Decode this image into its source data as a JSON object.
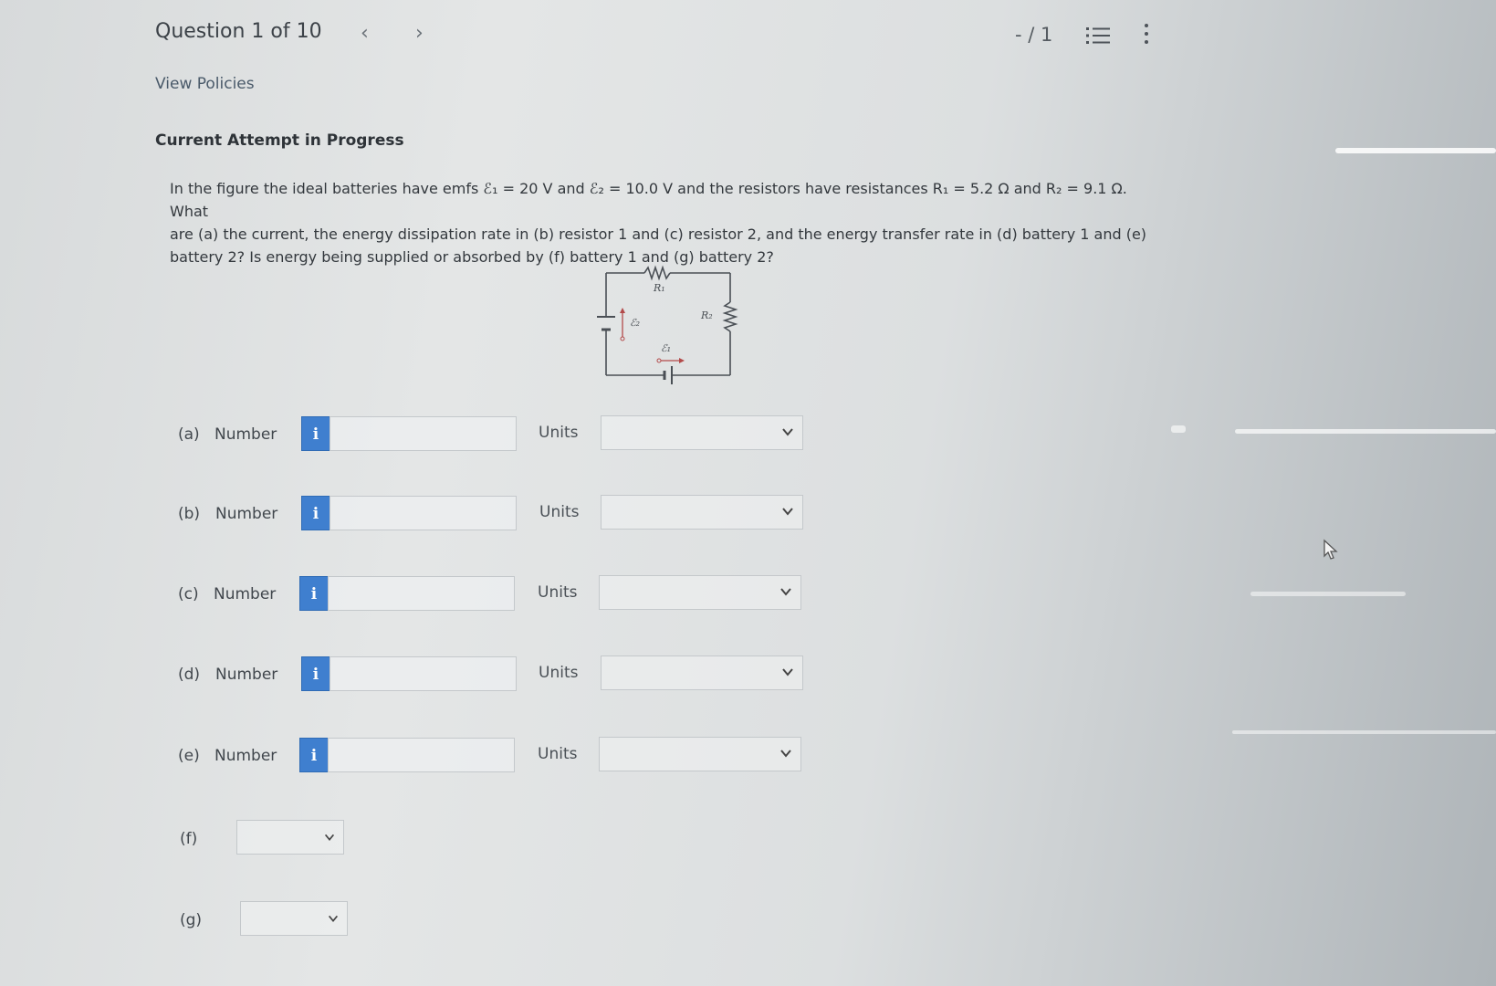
{
  "header": {
    "title": "Question 1 of 10",
    "prev_icon": "chevron-left-icon",
    "next_icon": "chevron-right-icon",
    "score": "- / 1",
    "list_icon": "list-icon",
    "more_icon": "more-vertical-icon"
  },
  "policies_link": "View Policies",
  "status": "Current Attempt in Progress",
  "question": {
    "line1": "In the figure the ideal batteries have emfs ℰ₁ = 20 V and ℰ₂ = 10.0 V and the resistors have resistances R₁ = 5.2 Ω and R₂ = 9.1 Ω. What",
    "line2": "are (a) the current, the energy dissipation rate in (b) resistor 1 and (c) resistor 2, and the energy transfer rate in (d) battery 1 and (e)",
    "line3": "battery 2? Is energy being supplied or absorbed by (f) battery 1 and (g) battery 2?"
  },
  "figure": {
    "r1": "R₁",
    "r2": "R₂",
    "e1": "ℰ₁",
    "e2": "ℰ₂"
  },
  "parts": [
    {
      "label": "(a)",
      "number_label": "Number",
      "info": "i",
      "value": "",
      "units_label": "Units",
      "units_value": ""
    },
    {
      "label": "(b)",
      "number_label": "Number",
      "info": "i",
      "value": "",
      "units_label": "Units",
      "units_value": ""
    },
    {
      "label": "(c)",
      "number_label": "Number",
      "info": "i",
      "value": "",
      "units_label": "Units",
      "units_value": ""
    },
    {
      "label": "(d)",
      "number_label": "Number",
      "info": "i",
      "value": "",
      "units_label": "Units",
      "units_value": ""
    },
    {
      "label": "(e)",
      "number_label": "Number",
      "info": "i",
      "value": "",
      "units_label": "Units",
      "units_value": ""
    }
  ],
  "choice_parts": [
    {
      "label": "(f)",
      "value": ""
    },
    {
      "label": "(g)",
      "value": ""
    }
  ],
  "colors": {
    "info_button": "#3f7fcf",
    "background": "#dcdfe0"
  }
}
